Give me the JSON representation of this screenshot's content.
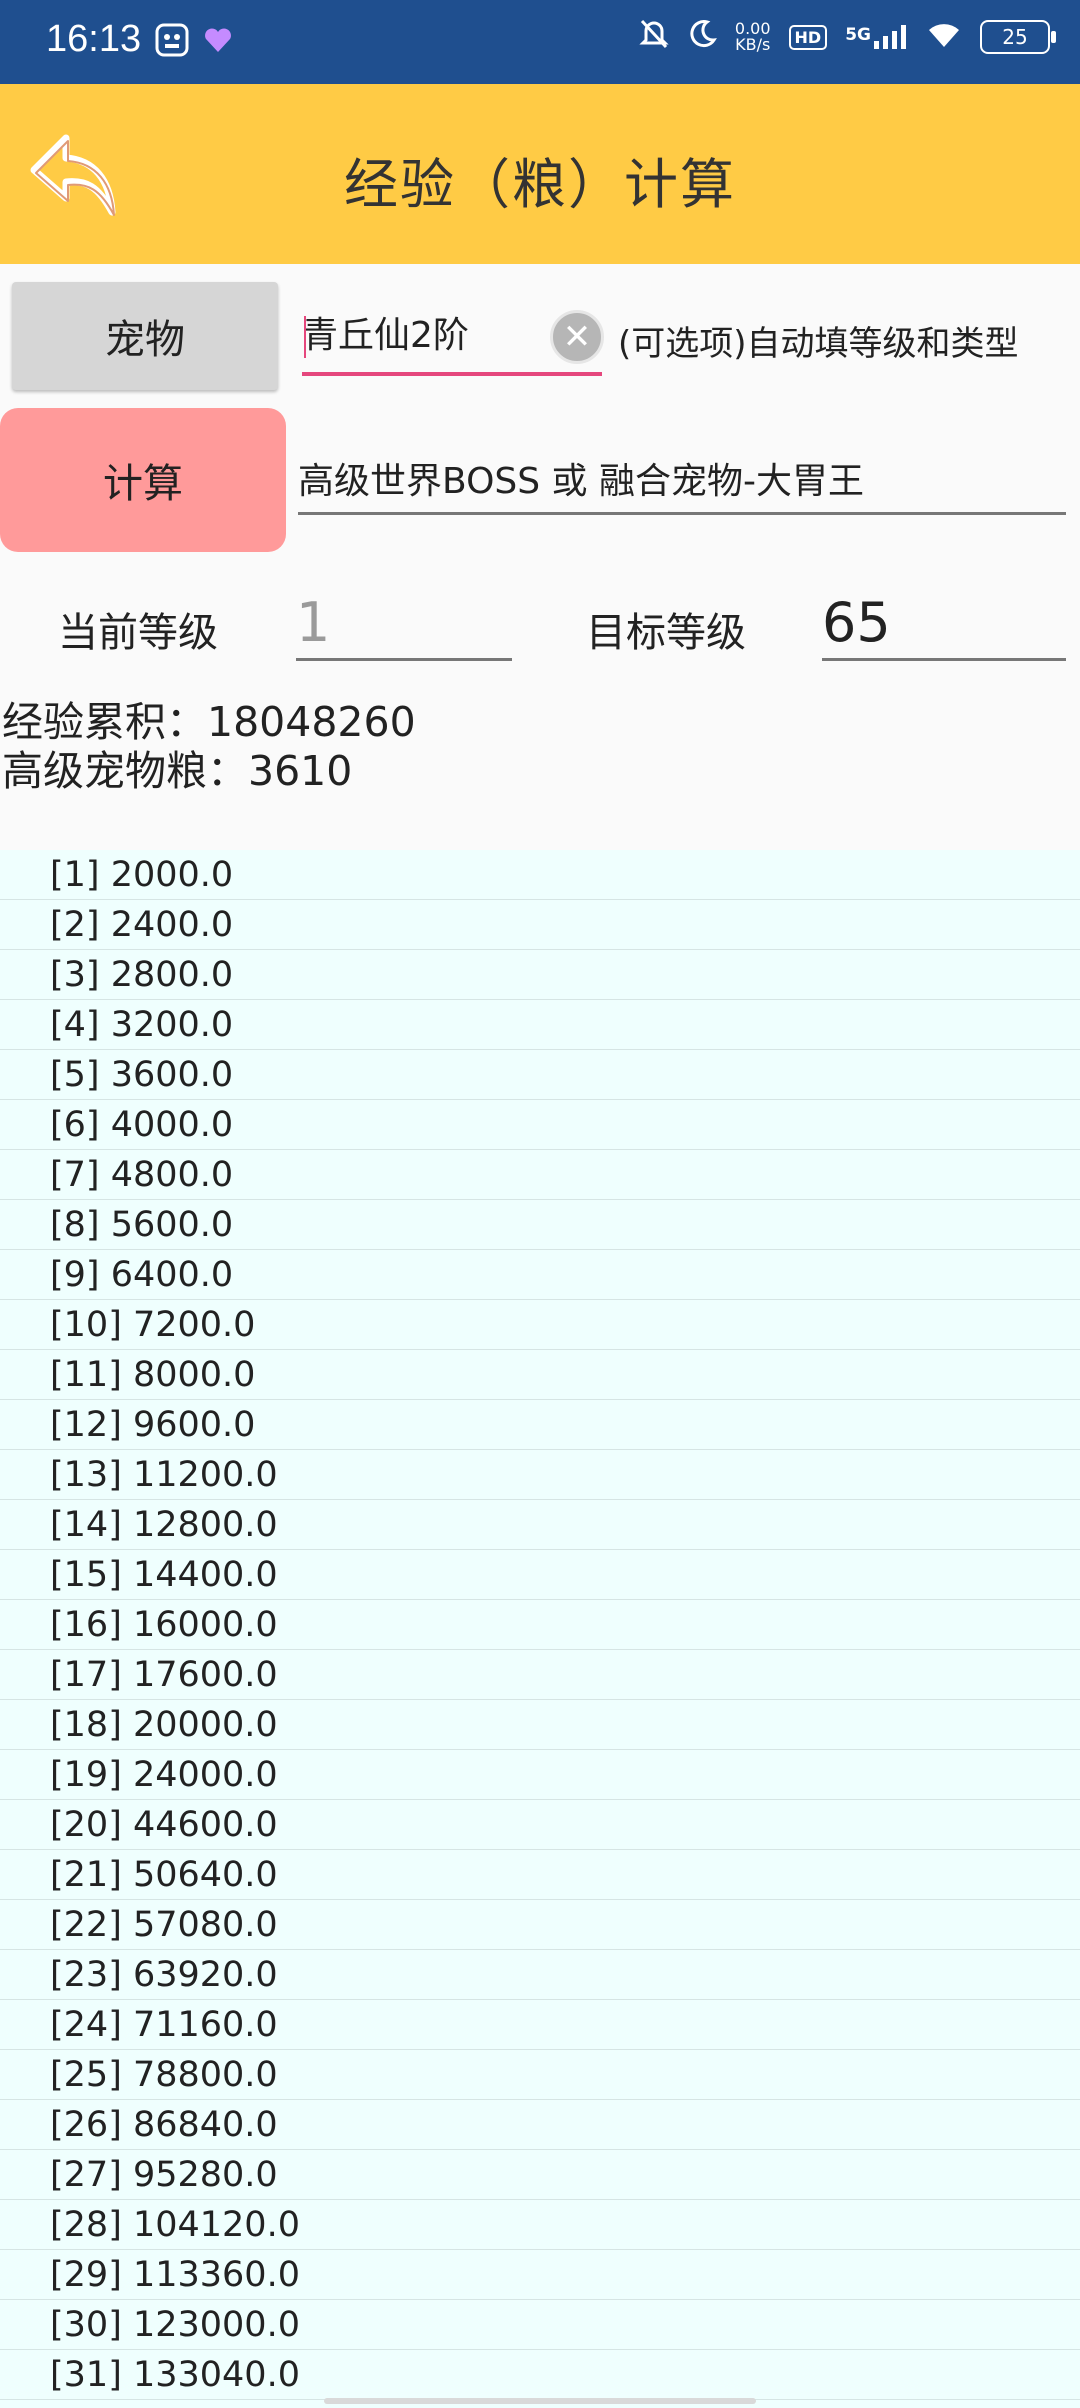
{
  "status_bar": {
    "time": "16:13",
    "net_speed_top": "0.00",
    "net_speed_unit": "KB/s",
    "hd_label": "HD",
    "network_label": "5G",
    "battery": "25"
  },
  "header": {
    "title": "经验（粮）计算"
  },
  "pet": {
    "button_label": "宠物",
    "input_value": "青丘仙2阶",
    "hint": "(可选项)自动填等级和类型"
  },
  "calc": {
    "button_label": "计算",
    "type_value": "高级世界BOSS 或 融合宠物-大胃王"
  },
  "levels": {
    "current_label": "当前等级",
    "current_value": "1",
    "target_label": "目标等级",
    "target_value": "65"
  },
  "summary": {
    "exp_total": "经验累积：18048260",
    "food_total": "高级宠物粮：3610"
  },
  "rows": [
    "[1] 2000.0",
    "[2] 2400.0",
    "[3] 2800.0",
    "[4] 3200.0",
    "[5] 3600.0",
    "[6] 4000.0",
    "[7] 4800.0",
    "[8] 5600.0",
    "[9] 6400.0",
    "[10] 7200.0",
    "[11] 8000.0",
    "[12] 9600.0",
    "[13] 11200.0",
    "[14] 12800.0",
    "[15] 14400.0",
    "[16] 16000.0",
    "[17] 17600.0",
    "[18] 20000.0",
    "[19] 24000.0",
    "[20] 44600.0",
    "[21] 50640.0",
    "[22] 57080.0",
    "[23] 63920.0",
    "[24] 71160.0",
    "[25] 78800.0",
    "[26] 86840.0",
    "[27] 95280.0",
    "[28] 104120.0",
    "[29] 113360.0",
    "[30] 123000.0",
    "[31] 133040.0"
  ],
  "colors": {
    "status_bar": "#1f4f8f",
    "header": "#ffcb45",
    "calc_button": "#ff9a9a",
    "input_accent": "#e5477d",
    "list_bg": "#effffe"
  }
}
